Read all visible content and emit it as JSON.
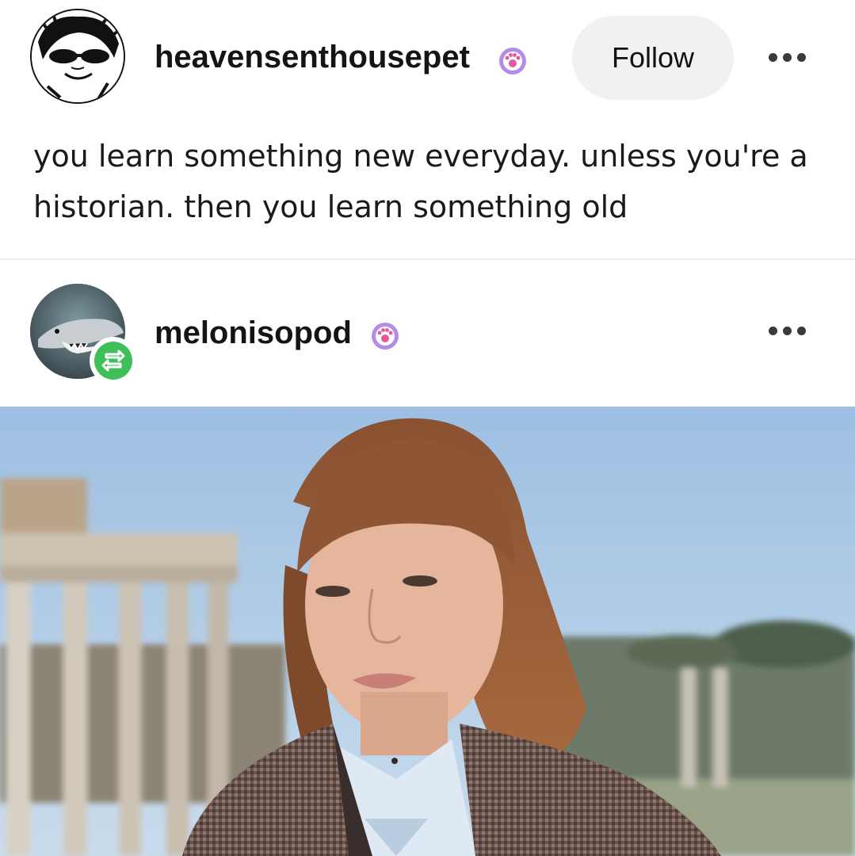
{
  "posts": [
    {
      "username": "heavensenthousepet",
      "follow_label": "Follow",
      "text": "you learn something new everyday. unless you're a historian. then you learn something old",
      "badge_icon": "paw-badge-icon",
      "avatar_icon": "sketch-avatar"
    },
    {
      "username": "melonisopod",
      "badge_icon": "paw-badge-icon",
      "avatar_icon": "shark-avatar",
      "reblog_icon": "reblog-icon"
    }
  ],
  "colors": {
    "badge_purple": "#9b6fd6",
    "reblog_green": "#3fbf5a",
    "follow_bg": "#f0f1f2",
    "sky": "#a9c6e3"
  }
}
